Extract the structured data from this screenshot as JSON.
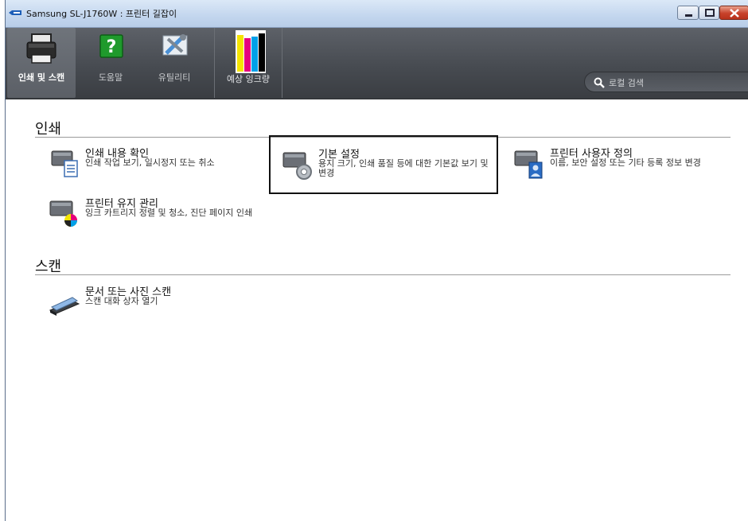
{
  "window": {
    "title": "Samsung SL-J1760W : 프린터 길잡이"
  },
  "toolbar": {
    "tabs": [
      {
        "label": "인쇄 및 스캔",
        "icon": "printer-icon",
        "active": true
      },
      {
        "label": "도움말",
        "icon": "help-icon",
        "active": false
      },
      {
        "label": "유틸리티",
        "icon": "tools-icon",
        "active": false
      },
      {
        "label": "예상 잉크량",
        "icon": "ink-level-icon",
        "active": false
      }
    ],
    "ink_colors": [
      "#f5e400",
      "#e6007e",
      "#00a0e9",
      "#000000"
    ]
  },
  "search": {
    "placeholder": "로컬 검색"
  },
  "sections": {
    "print": {
      "title": "인쇄",
      "items": [
        {
          "title": "인쇄 내용 확인",
          "desc": "인쇄 작업 보기, 일시정지 또는 취소",
          "icon": "print-queue-icon"
        },
        {
          "title": "기본 설정",
          "desc": "용지 크기, 인쇄 품질 등에 대한 기본값 보기 및 변경",
          "icon": "printer-settings-icon",
          "selected": true
        },
        {
          "title": "프린터 사용자 정의",
          "desc": "이름, 보안 설정 또는 기타 등록 정보 변경",
          "icon": "printer-user-icon"
        },
        {
          "title": "프린터 유지 관리",
          "desc": "잉크 카트리지 정렬 및 청소, 진단 페이지 인쇄",
          "icon": "printer-maintenance-icon"
        }
      ]
    },
    "scan": {
      "title": "스캔",
      "items": [
        {
          "title": "문서 또는 사진 스캔",
          "desc": "스캔 대화 상자 열기",
          "icon": "scanner-icon"
        }
      ]
    }
  },
  "colors": {
    "toolbar_bg": "#474b51",
    "titlebar_bg": "#c3d6ee",
    "close_button": "#c7412a",
    "selection_border": "#111111"
  }
}
